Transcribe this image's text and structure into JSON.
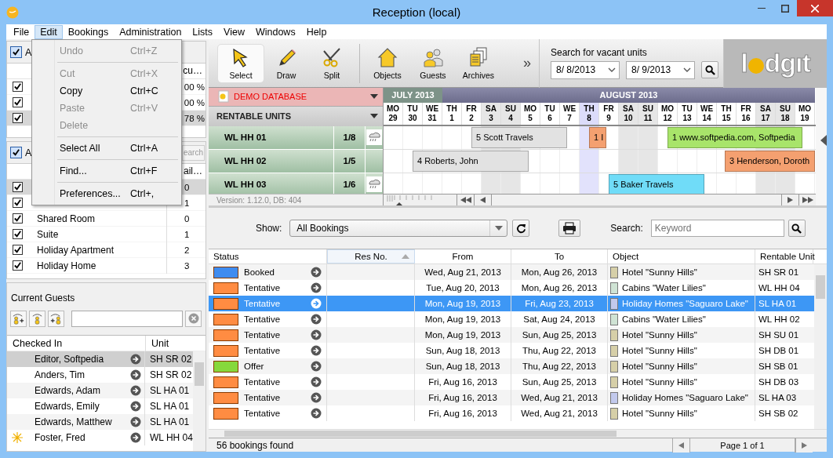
{
  "window": {
    "title": "Reception (local)"
  },
  "menu_bar": [
    {
      "label": "File",
      "selected": false
    },
    {
      "label": "Edit",
      "selected": true
    },
    {
      "label": "Bookings",
      "selected": false
    },
    {
      "label": "Administration",
      "selected": false
    },
    {
      "label": "Lists",
      "selected": false
    },
    {
      "label": "View",
      "selected": false
    },
    {
      "label": "Windows",
      "selected": false
    },
    {
      "label": "Help",
      "selected": false
    }
  ],
  "edit_menu": [
    {
      "kind": "item",
      "label": "Undo",
      "shortcut": "Ctrl+Z",
      "disabled": true
    },
    {
      "kind": "separator"
    },
    {
      "kind": "item",
      "label": "Cut",
      "shortcut": "Ctrl+X",
      "disabled": true
    },
    {
      "kind": "item",
      "label": "Copy",
      "shortcut": "Ctrl+C",
      "disabled": false
    },
    {
      "kind": "item",
      "label": "Paste",
      "shortcut": "Ctrl+V",
      "disabled": true
    },
    {
      "kind": "item",
      "label": "Delete",
      "disabled": true
    },
    {
      "kind": "separator"
    },
    {
      "kind": "item",
      "label": "Select All",
      "shortcut": "Ctrl+A",
      "disabled": false
    },
    {
      "kind": "separator"
    },
    {
      "kind": "item",
      "label": "Find...",
      "shortcut": "Ctrl+F",
      "disabled": false
    },
    {
      "kind": "separator"
    },
    {
      "kind": "item",
      "label": "Preferences...",
      "shortcut": "Ctrl+,",
      "disabled": false
    }
  ],
  "unit_filter": {
    "all_label": "A",
    "all_checked": true,
    "column_header": "cu…",
    "rows": [
      {
        "checked": true,
        "value": "00 %",
        "selected": false
      },
      {
        "checked": true,
        "value": "00 %",
        "selected": false
      },
      {
        "checked": true,
        "value": "78 %",
        "selected": true
      }
    ]
  },
  "category_filter": {
    "all_label": "A",
    "all_checked": true,
    "search_button": "earch",
    "column_header": "ail…",
    "rows": [
      {
        "checked": true,
        "value": "0",
        "selected": true
      },
      {
        "checked": true,
        "value": "1",
        "selected": false
      },
      {
        "checked": true,
        "name": "Shared Room",
        "value": "0",
        "selected": false
      },
      {
        "checked": true,
        "name": "Suite",
        "value": "1",
        "selected": false
      },
      {
        "checked": true,
        "name": "Holiday Apartment",
        "value": "2",
        "selected": false
      },
      {
        "checked": true,
        "name": "Holiday Home",
        "value": "3",
        "selected": false
      }
    ]
  },
  "current_guests": {
    "title": "Current Guests",
    "columns": [
      "Checked In",
      "Unit"
    ],
    "rows": [
      {
        "name": "Editor, Softpedia",
        "unit": "SH SR 02",
        "selected": true,
        "marked": false
      },
      {
        "name": "Anders, Tim",
        "unit": "SH SR 02",
        "selected": false,
        "marked": false
      },
      {
        "name": "Edwards, Adam",
        "unit": "SL HA 01",
        "selected": false,
        "marked": false
      },
      {
        "name": "Edwards, Emily",
        "unit": "SL HA 01",
        "selected": false,
        "marked": false
      },
      {
        "name": "Edwards, Matthew",
        "unit": "SL HA 01",
        "selected": false,
        "marked": false
      },
      {
        "name": "Foster, Fred",
        "unit": "WL HH 04",
        "selected": false,
        "marked": true
      }
    ]
  },
  "toolbar": {
    "tools": [
      {
        "label": "Select",
        "kind": "select",
        "selected": true
      },
      {
        "label": "Draw",
        "kind": "draw",
        "selected": false
      },
      {
        "label": "Split",
        "kind": "split",
        "selected": false
      }
    ],
    "views": [
      {
        "label": "Objects",
        "kind": "objects"
      },
      {
        "label": "Guests",
        "kind": "guests"
      },
      {
        "label": "Archives",
        "kind": "archives"
      }
    ],
    "more": "»"
  },
  "vacancy_search": {
    "title": "Search for vacant units",
    "from": "8/ 8/2013",
    "to": "8/ 9/2013"
  },
  "logo": {
    "before": "l",
    "after": "dgıt"
  },
  "calendar": {
    "zoom": {
      "level": 0.2
    },
    "database": "DEMO DATABASE",
    "units_header": "RENTABLE UNITS",
    "version": "Version: 1.12.0, DB: 404",
    "months": [
      {
        "label": "JULY 2013"
      },
      {
        "label": "AUGUST 2013"
      }
    ],
    "days": [
      {
        "dow": "MO",
        "day": "29",
        "weekend": false,
        "today": false
      },
      {
        "dow": "TU",
        "day": "30",
        "weekend": false,
        "today": false
      },
      {
        "dow": "WE",
        "day": "31",
        "weekend": false,
        "today": false
      },
      {
        "dow": "TH",
        "day": "1",
        "weekend": false,
        "today": false
      },
      {
        "dow": "FR",
        "day": "2",
        "weekend": false,
        "today": false
      },
      {
        "dow": "SA",
        "day": "3",
        "weekend": true,
        "today": false
      },
      {
        "dow": "SU",
        "day": "4",
        "weekend": true,
        "today": false
      },
      {
        "dow": "MO",
        "day": "5",
        "weekend": false,
        "today": false
      },
      {
        "dow": "TU",
        "day": "6",
        "weekend": false,
        "today": false
      },
      {
        "dow": "WE",
        "day": "7",
        "weekend": false,
        "today": false
      },
      {
        "dow": "TH",
        "day": "8",
        "weekend": false,
        "today": true
      },
      {
        "dow": "FR",
        "day": "9",
        "weekend": false,
        "today": false
      },
      {
        "dow": "SA",
        "day": "10",
        "weekend": true,
        "today": false
      },
      {
        "dow": "SU",
        "day": "11",
        "weekend": true,
        "today": false
      },
      {
        "dow": "MO",
        "day": "12",
        "weekend": false,
        "today": false
      },
      {
        "dow": "TU",
        "day": "13",
        "weekend": false,
        "today": false
      },
      {
        "dow": "WE",
        "day": "14",
        "weekend": false,
        "today": false
      },
      {
        "dow": "TH",
        "day": "15",
        "weekend": false,
        "today": false
      },
      {
        "dow": "FR",
        "day": "16",
        "weekend": false,
        "today": false
      },
      {
        "dow": "SA",
        "day": "17",
        "weekend": true,
        "today": false
      },
      {
        "dow": "SU",
        "day": "18",
        "weekend": true,
        "today": false
      },
      {
        "dow": "MO",
        "day": "19",
        "weekend": false,
        "today": false
      }
    ],
    "units": [
      {
        "name": "WL HH 01",
        "occupancy": "1/8",
        "icon": true,
        "bookings": [
          {
            "label": "5 Scott Travels",
            "color": "#e2e2e2"
          },
          {
            "label": "1 I",
            "color": "#f4a070"
          },
          {
            "label": "1 www.softpedia.com, Softpedia",
            "color": "#a8e46a"
          }
        ]
      },
      {
        "name": "WL HH 02",
        "occupancy": "1/5",
        "icon": false,
        "bookings": [
          {
            "label": "4 Roberts, John",
            "color": "#e2e2e2"
          },
          {
            "label": "3 Henderson, Doroth",
            "color": "#f4a070"
          }
        ]
      },
      {
        "name": "WL HH 03",
        "occupancy": "1/6",
        "icon": true,
        "bookings": [
          {
            "label": "5 Baker Travels",
            "color": "#70dcf8"
          }
        ]
      }
    ]
  },
  "bookings": {
    "show_label": "Show:",
    "filter": "All Bookings",
    "search_label": "Search:",
    "search_placeholder": "Keyword",
    "columns": [
      {
        "label": "Status",
        "sorted": false
      },
      {
        "label": "Res No.",
        "sorted": true
      },
      {
        "label": "From",
        "sorted": false
      },
      {
        "label": "To",
        "sorted": false
      },
      {
        "label": "Object",
        "sorted": false
      },
      {
        "label": "Rentable Unit",
        "sorted": false
      }
    ],
    "rows": [
      {
        "status": {
          "label": "Booked",
          "color": "#3f8cf0"
        },
        "from": "Wed, Aug 21, 2013",
        "to": "Mon, Aug 26, 2013",
        "object": {
          "label": "Hotel \"Sunny Hills\"",
          "color": "#d6cfa8"
        },
        "unit": "SH SR 01",
        "selected": false
      },
      {
        "status": {
          "label": "Tentative",
          "color": "#ff8c42"
        },
        "from": "Tue, Aug 20, 2013",
        "to": "Mon, Aug 26, 2013",
        "object": {
          "label": "Cabins \"Water Lilies\"",
          "color": "#cfe3d4"
        },
        "unit": "WL HH 04",
        "selected": false
      },
      {
        "status": {
          "label": "Tentative",
          "color": "#ff8c42"
        },
        "from": "Mon, Aug 19, 2013",
        "to": "Fri, Aug 23, 2013",
        "object": {
          "label": "Holiday Homes \"Saguaro Lake\"",
          "color": "#c2c9ec"
        },
        "unit": "SL HA 01",
        "selected": true
      },
      {
        "status": {
          "label": "Tentative",
          "color": "#ff8c42"
        },
        "from": "Mon, Aug 19, 2013",
        "to": "Sat, Aug 24, 2013",
        "object": {
          "label": "Cabins \"Water Lilies\"",
          "color": "#cfe3d4"
        },
        "unit": "WL HH 02",
        "selected": false
      },
      {
        "status": {
          "label": "Tentative",
          "color": "#ff8c42"
        },
        "from": "Mon, Aug 19, 2013",
        "to": "Sun, Aug 25, 2013",
        "object": {
          "label": "Hotel \"Sunny Hills\"",
          "color": "#d6cfa8"
        },
        "unit": "SH SU 01",
        "selected": false
      },
      {
        "status": {
          "label": "Tentative",
          "color": "#ff8c42"
        },
        "from": "Sun, Aug 18, 2013",
        "to": "Thu, Aug 22, 2013",
        "object": {
          "label": "Hotel \"Sunny Hills\"",
          "color": "#d6cfa8"
        },
        "unit": "SH DB 01",
        "selected": false
      },
      {
        "status": {
          "label": "Offer",
          "color": "#86d83c"
        },
        "from": "Sun, Aug 18, 2013",
        "to": "Thu, Aug 22, 2013",
        "object": {
          "label": "Hotel \"Sunny Hills\"",
          "color": "#d6cfa8"
        },
        "unit": "SH SB 01",
        "selected": false
      },
      {
        "status": {
          "label": "Tentative",
          "color": "#ff8c42"
        },
        "from": "Fri, Aug 16, 2013",
        "to": "Sun, Aug 25, 2013",
        "object": {
          "label": "Hotel \"Sunny Hills\"",
          "color": "#d6cfa8"
        },
        "unit": "SH DB 03",
        "selected": false
      },
      {
        "status": {
          "label": "Tentative",
          "color": "#ff8c42"
        },
        "from": "Fri, Aug 16, 2013",
        "to": "Wed, Aug 21, 2013",
        "object": {
          "label": "Holiday Homes \"Saguaro Lake\"",
          "color": "#c2c9ec"
        },
        "unit": "SL HA 03",
        "selected": false
      },
      {
        "status": {
          "label": "Tentative",
          "color": "#ff8c42"
        },
        "from": "Fri, Aug 16, 2013",
        "to": "Wed, Aug 21, 2013",
        "object": {
          "label": "Hotel \"Sunny Hills\"",
          "color": "#d6cfa8"
        },
        "unit": "SH SB 02",
        "selected": false
      }
    ],
    "count": "56 bookings found",
    "page": "Page 1 of 1"
  }
}
